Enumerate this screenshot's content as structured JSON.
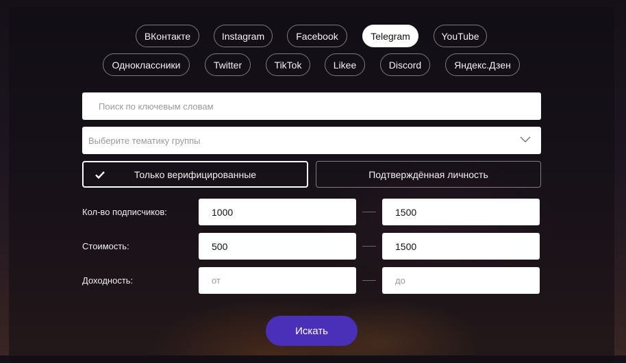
{
  "networks_row1": [
    "ВКонтакте",
    "Instagram",
    "Facebook",
    "Telegram",
    "YouTube"
  ],
  "networks_row2": [
    "Одноклассники",
    "Twitter",
    "TikTok",
    "Likee",
    "Discord",
    "Яндекс.Дзен"
  ],
  "active_network": "Telegram",
  "search": {
    "placeholder": "Поиск по ключевым словам"
  },
  "topic_select": {
    "placeholder": "Выберите тематику группы"
  },
  "toggles": {
    "verified_label": "Только верифицированные",
    "verified_checked": true,
    "identity_label": "Подтверждённая личность",
    "identity_checked": false
  },
  "filters": {
    "subscribers": {
      "label": "Кол-во подписчиков:",
      "from": "1000",
      "to": "1500"
    },
    "cost": {
      "label": "Стоимость:",
      "from": "500",
      "to": "1500"
    },
    "income": {
      "label": "Доходность:",
      "from_placeholder": "от",
      "to_placeholder": "до"
    }
  },
  "submit_label": "Искать",
  "colors": {
    "accent": "#4a2fb8",
    "panel": "#100d12"
  }
}
